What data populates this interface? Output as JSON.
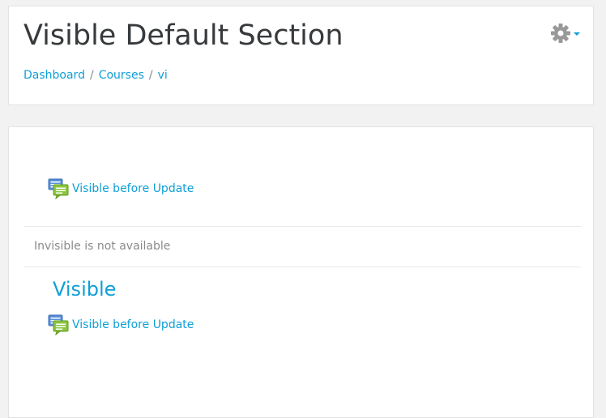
{
  "header": {
    "title": "Visible Default Section",
    "breadcrumb": [
      "Dashboard",
      "Courses",
      "vi"
    ],
    "breadcrumb_separator": "/",
    "settings_icon": "gear-icon"
  },
  "section0": {
    "activity": {
      "icon": "forum-icon",
      "label": "Visible before Update"
    }
  },
  "section_invisible": {
    "notice": "Invisible is not available"
  },
  "section_visible": {
    "title": "Visible",
    "activity": {
      "icon": "forum-icon",
      "label": "Visible before Update"
    }
  },
  "colors": {
    "link": "#0f9fd6",
    "title": "#373a3c",
    "muted": "#8a8a8a",
    "gear": "#999999",
    "forum_blue": "#5a8fd8",
    "forum_green": "#8cc63f"
  }
}
